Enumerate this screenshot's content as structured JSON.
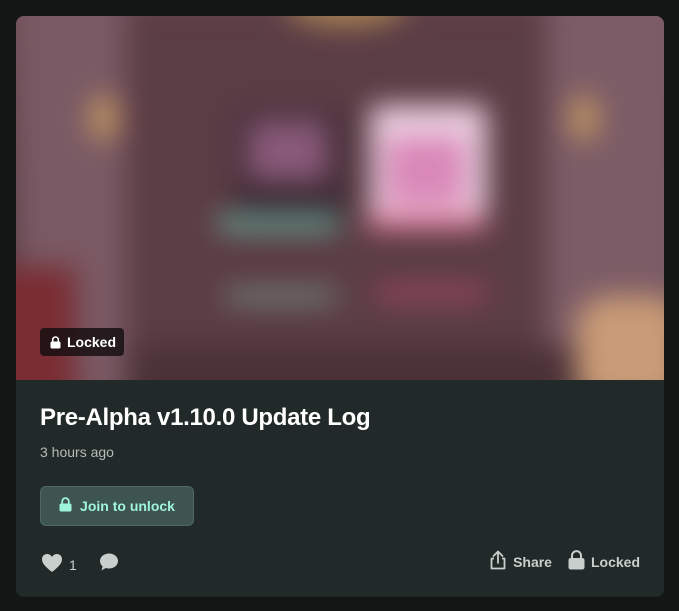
{
  "post": {
    "locked_badge": "Locked",
    "title": "Pre-Alpha v1.10.0 Update Log",
    "timestamp": "3 hours ago",
    "join_label": "Join to unlock",
    "like_count": "1",
    "share_label": "Share",
    "locked_label": "Locked"
  },
  "icons": {
    "badge": "lock-icon",
    "join": "lock-icon",
    "like": "heart-icon",
    "comment": "comment-icon",
    "share": "share-icon",
    "locked": "lock-icon"
  },
  "colors": {
    "page_bg": "#131615",
    "card_bg": "#212a28",
    "button_bg": "#3e544e",
    "button_text": "#9ff5dc",
    "title_text": "#ffffff",
    "muted_text": "#b6bcba"
  }
}
